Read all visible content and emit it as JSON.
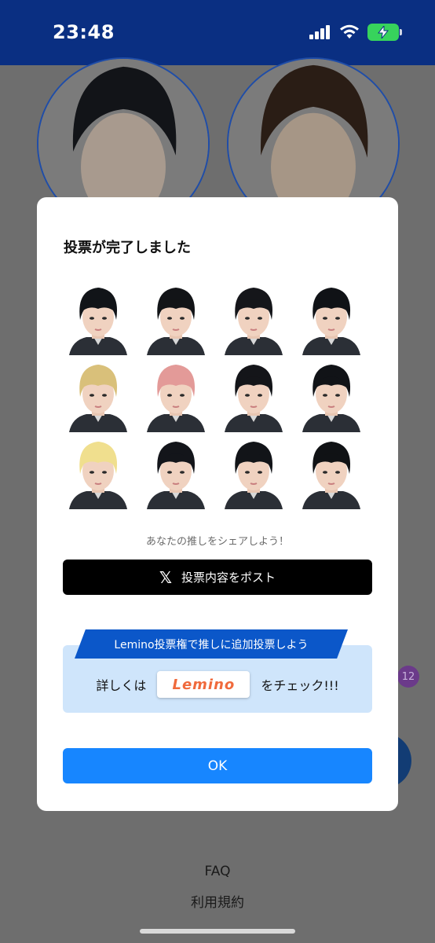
{
  "status_bar": {
    "time": "23:48"
  },
  "background": {
    "links": {
      "faq": "FAQ",
      "terms": "利用規約"
    },
    "badge_count": "12"
  },
  "modal": {
    "title": "投票が完了しました",
    "share_prompt": "あなたの推しをシェアしよう！",
    "post_button_label": "投票内容をポスト",
    "lemino": {
      "banner": "Lemino投票権で推しに追加投票しよう",
      "prefix": "詳しくは",
      "logo": "Lemino",
      "suffix": "をチェック!!!"
    },
    "ok_label": "OK",
    "members": [
      {
        "hair": "#111418"
      },
      {
        "hair": "#121417"
      },
      {
        "hair": "#15161a"
      },
      {
        "hair": "#101216"
      },
      {
        "hair": "#d9c07a"
      },
      {
        "hair": "#e39a98"
      },
      {
        "hair": "#141519"
      },
      {
        "hair": "#111317"
      },
      {
        "hair": "#f0df8e"
      },
      {
        "hair": "#13151a"
      },
      {
        "hair": "#121418"
      },
      {
        "hair": "#101215"
      }
    ]
  },
  "colors": {
    "status_bar": "#0a2f82",
    "ok_button": "#1786ff",
    "lemino_banner": "#0b57c9",
    "lemino_box": "#cfe5fb"
  }
}
